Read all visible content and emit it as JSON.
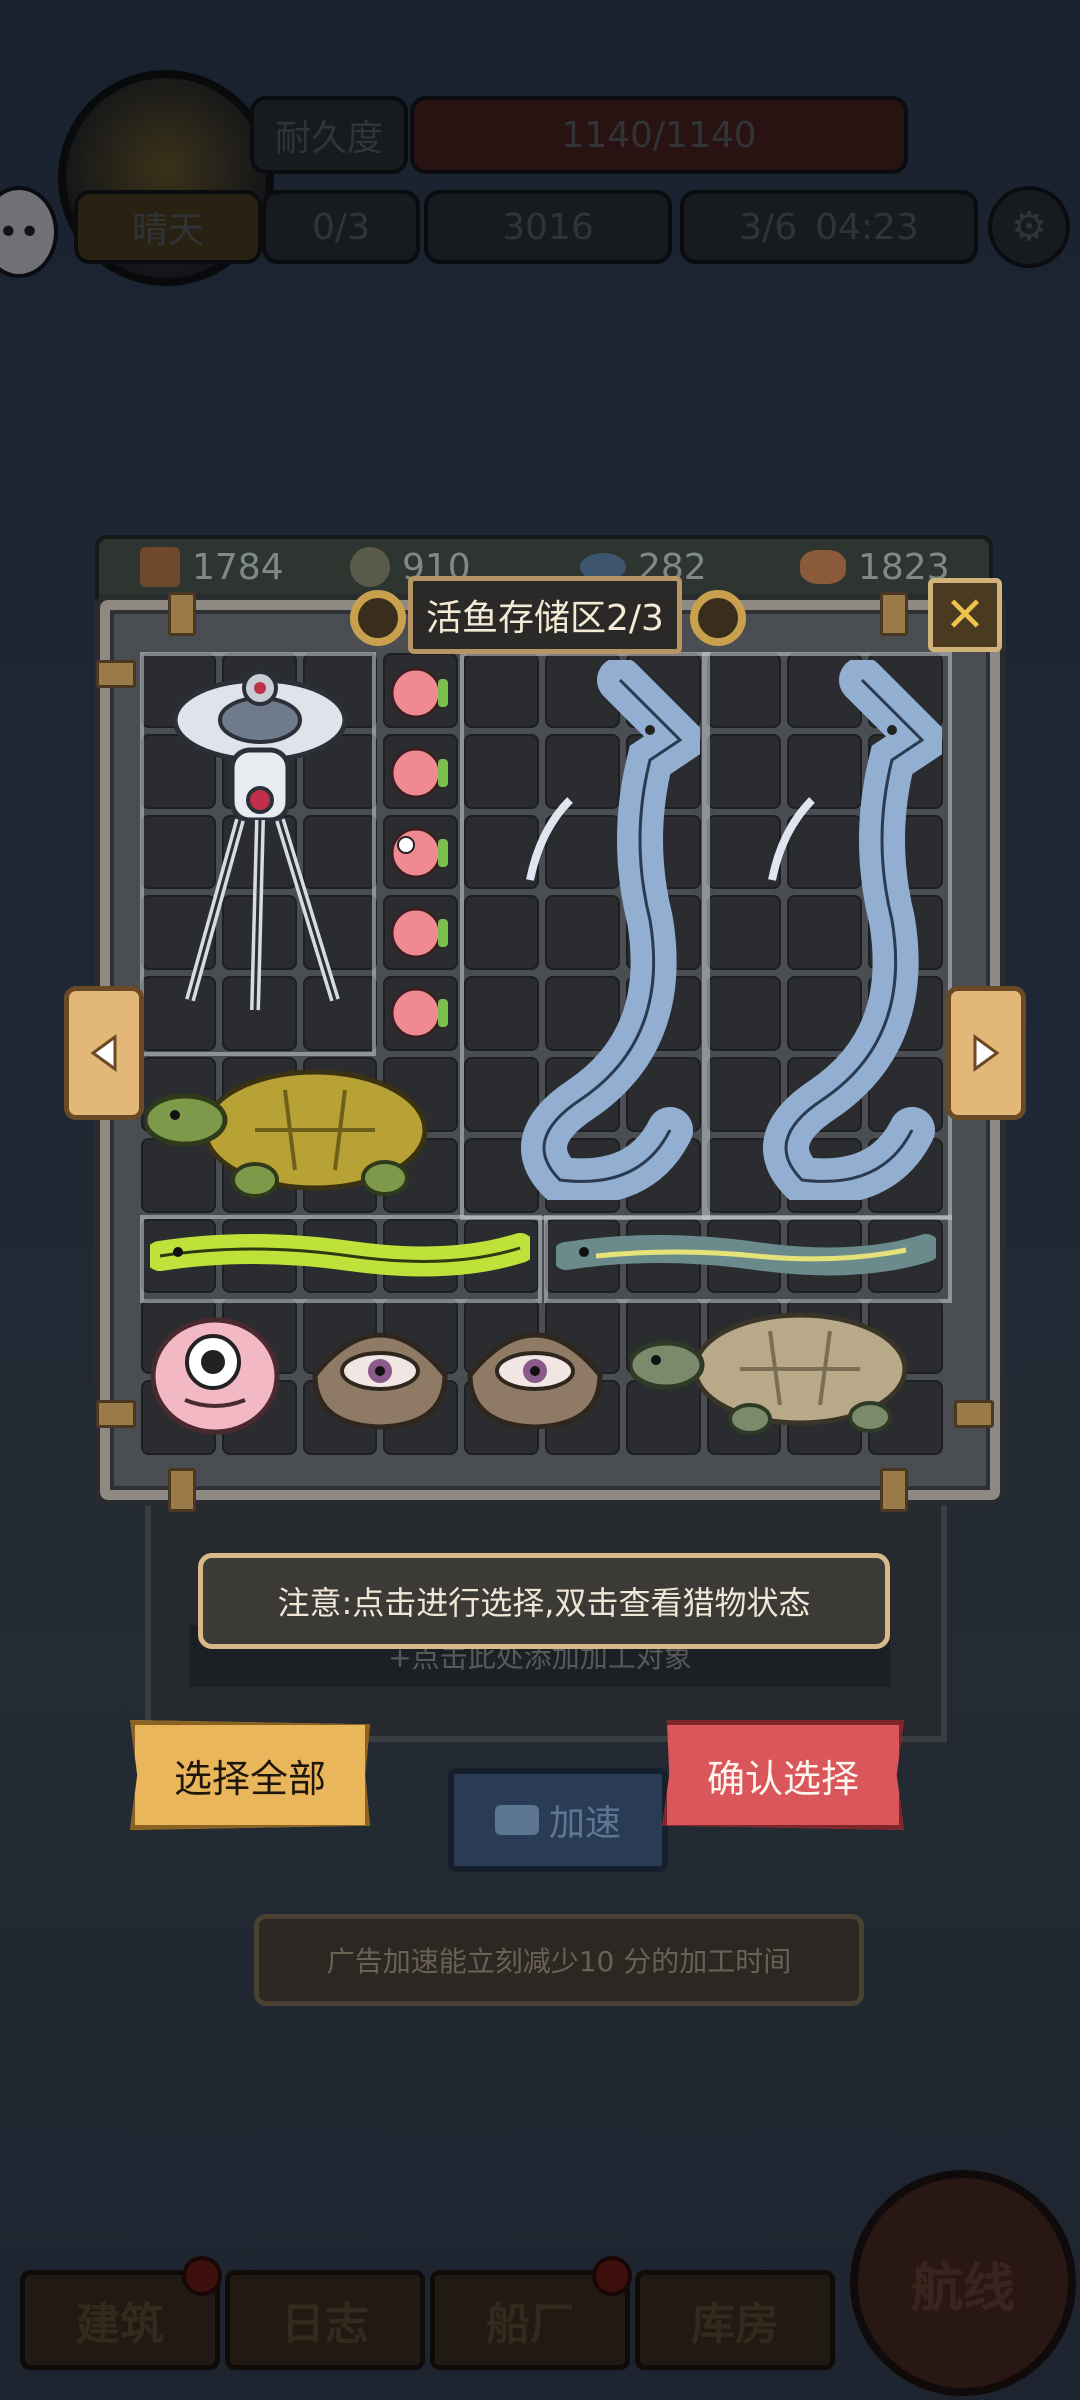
{
  "hud": {
    "durability_label": "耐久度",
    "durability_value": "1140/1140",
    "weather": "晴天",
    "hammer_count": "0/3",
    "coins": "3016",
    "energy": "3/6",
    "energy_timer": "04:23"
  },
  "resources": [
    {
      "icon": "wood-icon",
      "value": "1784"
    },
    {
      "icon": "crew-icon",
      "value": "910"
    },
    {
      "icon": "fish-icon",
      "value": "282"
    },
    {
      "icon": "meat-icon",
      "value": "1823"
    }
  ],
  "dialog": {
    "title": "活鱼存储区2/3",
    "close_glyph": "✕",
    "notice": "注意:点击进行选择,双击查看猎物状态",
    "add_target": "+点击此处添加加工对象",
    "select_all": "选择全部",
    "confirm": "确认选择",
    "speed_up": "加速",
    "ad_tip": "广告加速能立刻减少10 分的加工时间"
  },
  "items": [
    {
      "name": "robot-tripod-creature",
      "kind": "mech"
    },
    {
      "name": "pink-puffer-fish",
      "count": 5
    },
    {
      "name": "blue-sea-serpent",
      "count": 2
    },
    {
      "name": "yellow-turtle"
    },
    {
      "name": "green-electric-eel"
    },
    {
      "name": "blue-electric-eel"
    },
    {
      "name": "pink-eyeball-blob"
    },
    {
      "name": "eye-shell-clam",
      "count": 2
    },
    {
      "name": "grey-turtle"
    }
  ],
  "bottom_nav": [
    "建筑",
    "日志",
    "船厂",
    "库房"
  ],
  "route_button": "航线",
  "colors": {
    "accent_gold": "#e9b65c",
    "confirm_red": "#d9565a",
    "frame": "#8e8a83"
  }
}
